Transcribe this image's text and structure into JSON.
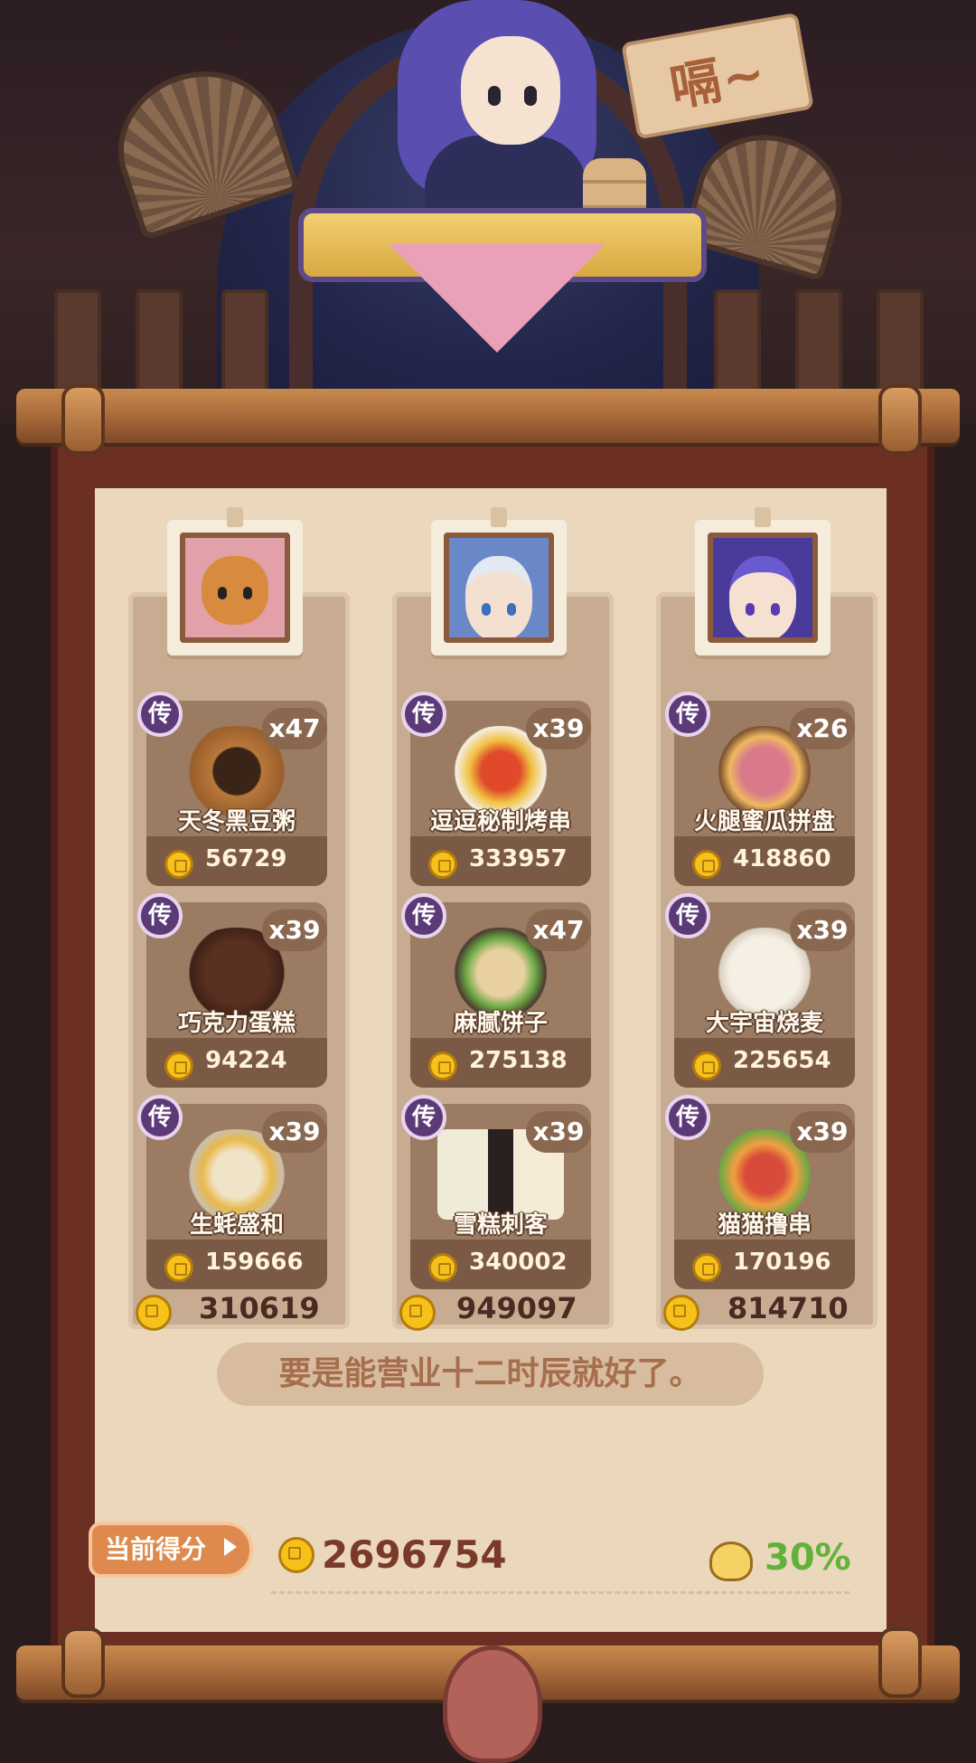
{
  "scene": {
    "speech_sign": "嗝~"
  },
  "columns": [
    {
      "character": "bear-chef",
      "total": "310619",
      "dishes": [
        {
          "badge": "传",
          "name": "天冬黑豆粥",
          "qty": "x47",
          "price": "56729"
        },
        {
          "badge": "传",
          "name": "巧克力蛋糕",
          "qty": "x39",
          "price": "94224"
        },
        {
          "badge": "传",
          "name": "生蚝盛和",
          "qty": "x39",
          "price": "159666"
        }
      ]
    },
    {
      "character": "silver-hair-boy",
      "total": "949097",
      "dishes": [
        {
          "badge": "传",
          "name": "逗逗秘制烤串",
          "qty": "x39",
          "price": "333957"
        },
        {
          "badge": "传",
          "name": "麻腻饼子",
          "qty": "x47",
          "price": "275138"
        },
        {
          "badge": "传",
          "name": "雪糕刺客",
          "qty": "x39",
          "price": "340002"
        }
      ]
    },
    {
      "character": "purple-hair-girl",
      "total": "814710",
      "dishes": [
        {
          "badge": "传",
          "name": "火腿蜜瓜拼盘",
          "qty": "x26",
          "price": "418860"
        },
        {
          "badge": "传",
          "name": "大宇宙烧麦",
          "qty": "x39",
          "price": "225654"
        },
        {
          "badge": "传",
          "name": "猫猫撸串",
          "qty": "x39",
          "price": "170196"
        }
      ]
    }
  ],
  "quote": "要是能营业十二时辰就好了。",
  "score": {
    "label": "当前得分",
    "value": "2696754",
    "bonus": "30%"
  },
  "colors": {
    "badge": "#5c3a78",
    "coin": "#f6c21a",
    "bonus": "#62b23a",
    "scroll_rod": "#a86a3a"
  }
}
